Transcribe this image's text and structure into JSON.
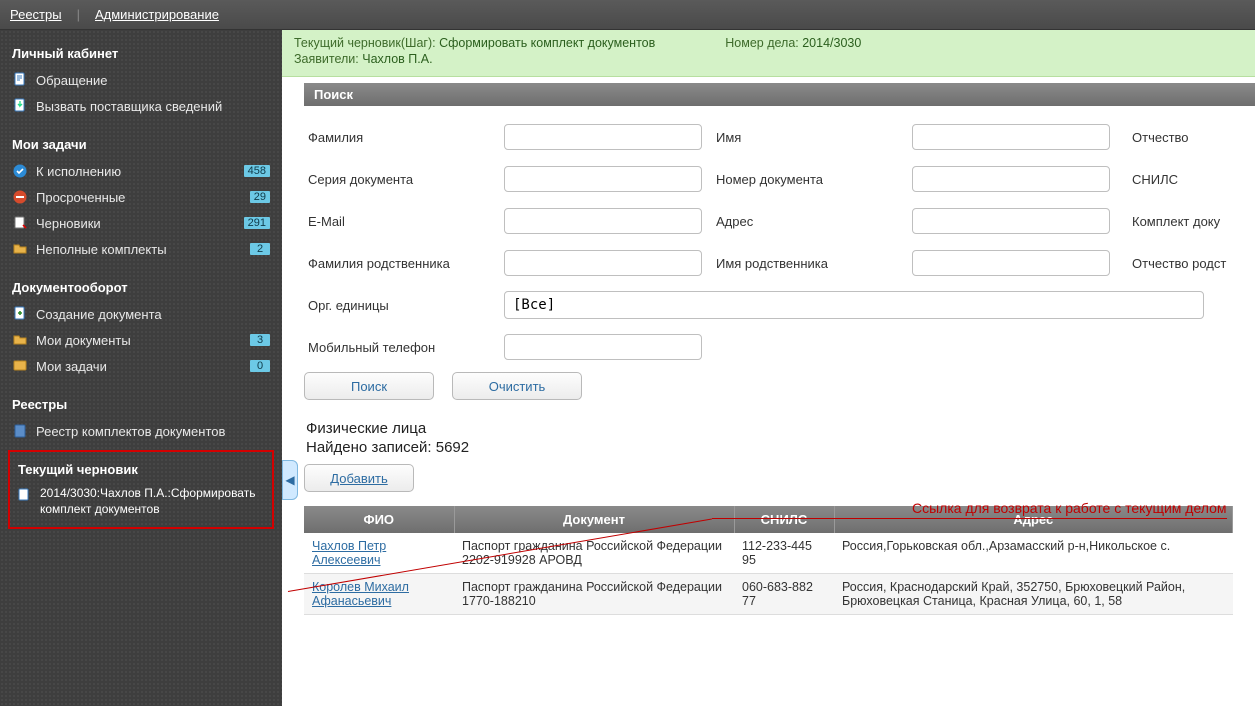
{
  "topnav": {
    "registries": "Реестры",
    "admin": "Администрирование"
  },
  "sidebar": {
    "section1": "Личный кабинет",
    "items1": [
      {
        "label": "Обращение"
      },
      {
        "label": "Вызвать поставщика сведений"
      }
    ],
    "section2": "Мои задачи",
    "items2": [
      {
        "label": "К исполнению",
        "badge": "458",
        "icon": "ok"
      },
      {
        "label": "Просроченные",
        "badge": "29",
        "icon": "deny"
      },
      {
        "label": "Черновики",
        "badge": "291",
        "icon": "draft"
      },
      {
        "label": "Неполные комплекты",
        "badge": "2",
        "icon": "folder"
      }
    ],
    "section3": "Документооборот",
    "items3": [
      {
        "label": "Создание документа",
        "badge": ""
      },
      {
        "label": "Мои документы",
        "badge": "3"
      },
      {
        "label": "Мои задачи",
        "badge": "0"
      }
    ],
    "section4": "Реестры",
    "items4": [
      {
        "label": "Реестр комплектов документов"
      }
    ],
    "current_draft_header": "Текущий черновик",
    "current_draft": "2014/3030:Чахлов П.А.:Сформировать комплект документов"
  },
  "status": {
    "step_k": "Текущий черновик(Шаг):",
    "step_v": "Сформировать комплект документов",
    "case_k": "Номер дела:",
    "case_v": "2014/3030",
    "appl_k": "Заявители:",
    "appl_v": "Чахлов П.А."
  },
  "search": {
    "panel_title": "Поиск",
    "labels": {
      "lastname": "Фамилия",
      "firstname": "Имя",
      "patronymic": "Отчество",
      "doc_series": "Серия документа",
      "doc_no": "Номер документа",
      "snils": "СНИЛС",
      "email": "E-Mail",
      "address": "Адрес",
      "doc_set": "Комплект доку",
      "rel_last": "Фамилия родственника",
      "rel_first": "Имя родственника",
      "rel_patr": "Отчество родст",
      "org": "Орг. единицы",
      "phone": "Мобильный телефон"
    },
    "org_value": "[Все]",
    "btn_search": "Поиск",
    "btn_clear": "Очистить"
  },
  "results": {
    "heading": "Физические лица",
    "count_prefix": "Найдено записей:",
    "count": "5692",
    "btn_add": "Добавить",
    "cols": {
      "fio": "ФИО",
      "doc": "Документ",
      "snils": "СНИЛС",
      "addr": "Адрес"
    },
    "rows": [
      {
        "fio": "Чахлов Петр Алексеевич",
        "doc": "Паспорт гражданина Российской Федерации 2202-919928 АРОВД",
        "snils": "112-233-445 95",
        "addr": "Россия,Горьковская обл.,Арзамасский р-н,Никольское с."
      },
      {
        "fio": "Королев Михаил Афанасьевич",
        "doc": "Паспорт гражданина Российской Федерации 1770-188210",
        "snils": "060-683-882 77",
        "addr": "Россия, Краснодарский Край, 352750, Брюховецкий Район, Брюховецкая Станица, Красная Улица, 60, 1, 58"
      }
    ]
  },
  "annotation": "Ссылка для возврата к работе с текущим делом"
}
